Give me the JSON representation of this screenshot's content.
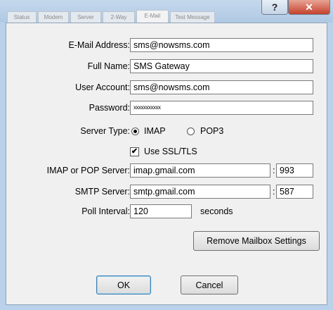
{
  "window": {
    "help_glyph": "?",
    "close_glyph": "✕",
    "background_tabs": [
      "Status",
      "Modem",
      "Server",
      "2-Way",
      "E-Mail",
      "Test Message"
    ]
  },
  "form": {
    "email_address": {
      "label": "E-Mail Address:",
      "value": "sms@nowsms.com"
    },
    "full_name": {
      "label": "Full Name:",
      "value": "SMS Gateway"
    },
    "user_account": {
      "label": "User Account:",
      "value": "sms@nowsms.com"
    },
    "password": {
      "label": "Password:",
      "value": "xxxxxxxxxxx"
    },
    "server_type": {
      "label": "Server Type:",
      "options": [
        {
          "label": "IMAP",
          "selected": true
        },
        {
          "label": "POP3",
          "selected": false
        }
      ]
    },
    "use_ssl": {
      "label": "Use SSL/TLS",
      "checked": true,
      "check_glyph": "✔"
    },
    "imap_pop_server": {
      "label": "IMAP or POP Server:",
      "value": "imap.gmail.com",
      "separator": ":",
      "port": "993"
    },
    "smtp_server": {
      "label": "SMTP Server:",
      "value": "smtp.gmail.com",
      "separator": ":",
      "port": "587"
    },
    "poll_interval": {
      "label": "Poll Interval:",
      "value": "120",
      "unit": "seconds"
    }
  },
  "buttons": {
    "remove_mailbox": "Remove Mailbox Settings",
    "ok": "OK",
    "cancel": "Cancel"
  }
}
